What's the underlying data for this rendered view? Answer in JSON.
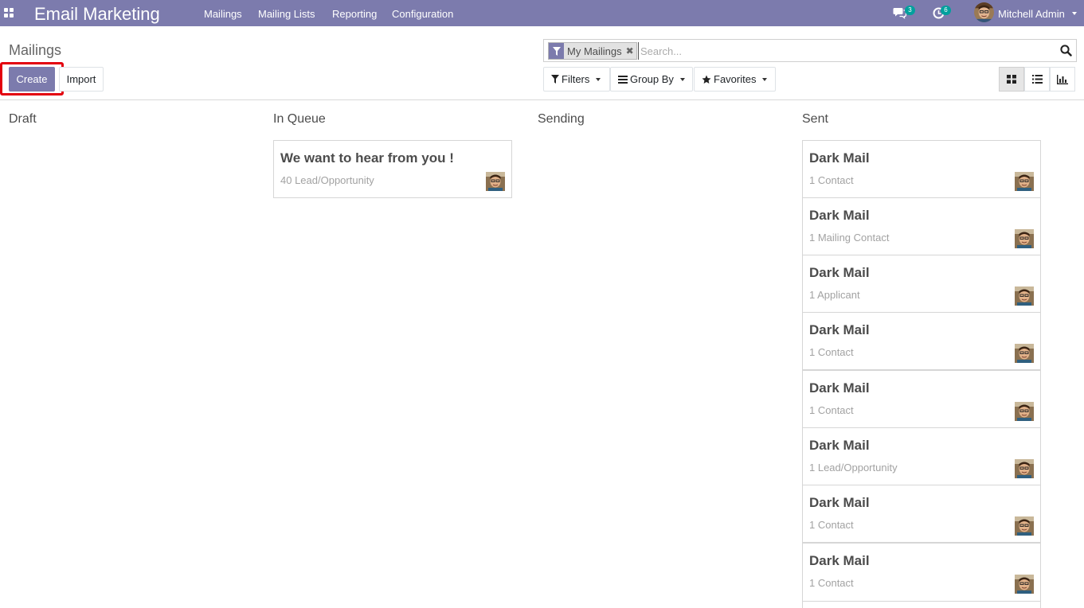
{
  "navbar": {
    "brand": "Email Marketing",
    "menu": [
      "Mailings",
      "Mailing Lists",
      "Reporting",
      "Configuration"
    ],
    "messages_count": "3",
    "activities_count": "6",
    "user_name": "Mitchell Admin"
  },
  "control_panel": {
    "title": "Mailings",
    "create_label": "Create",
    "import_label": "Import",
    "facet_label": "My Mailings",
    "facet_remove": "✖",
    "search_placeholder": "Search...",
    "filters_label": "Filters",
    "group_by_label": "Group By",
    "favorites_label": "Favorites"
  },
  "colors": {
    "brand": "#7c7bad",
    "badge": "#00a09d",
    "highlight": "#e3000f"
  },
  "kanban": {
    "columns": [
      {
        "title": "Draft",
        "cards": []
      },
      {
        "title": "In Queue",
        "cards": [
          {
            "title": "We want to hear from you !",
            "subtitle": "40 Lead/Opportunity"
          }
        ]
      },
      {
        "title": "Sending",
        "cards": []
      },
      {
        "title": "Sent",
        "cards": [
          {
            "title": "Dark Mail",
            "subtitle": "1 Contact"
          },
          {
            "title": "Dark Mail",
            "subtitle": "1 Mailing Contact"
          },
          {
            "title": "Dark Mail",
            "subtitle": "1 Applicant"
          },
          {
            "title": "Dark Mail",
            "subtitle": "1 Contact"
          },
          {
            "title": "Dark Mail",
            "subtitle": "1 Contact"
          },
          {
            "title": "Dark Mail",
            "subtitle": "1 Lead/Opportunity"
          },
          {
            "title": "Dark Mail",
            "subtitle": "1 Contact"
          },
          {
            "title": "Dark Mail",
            "subtitle": "1 Contact"
          }
        ]
      }
    ]
  }
}
